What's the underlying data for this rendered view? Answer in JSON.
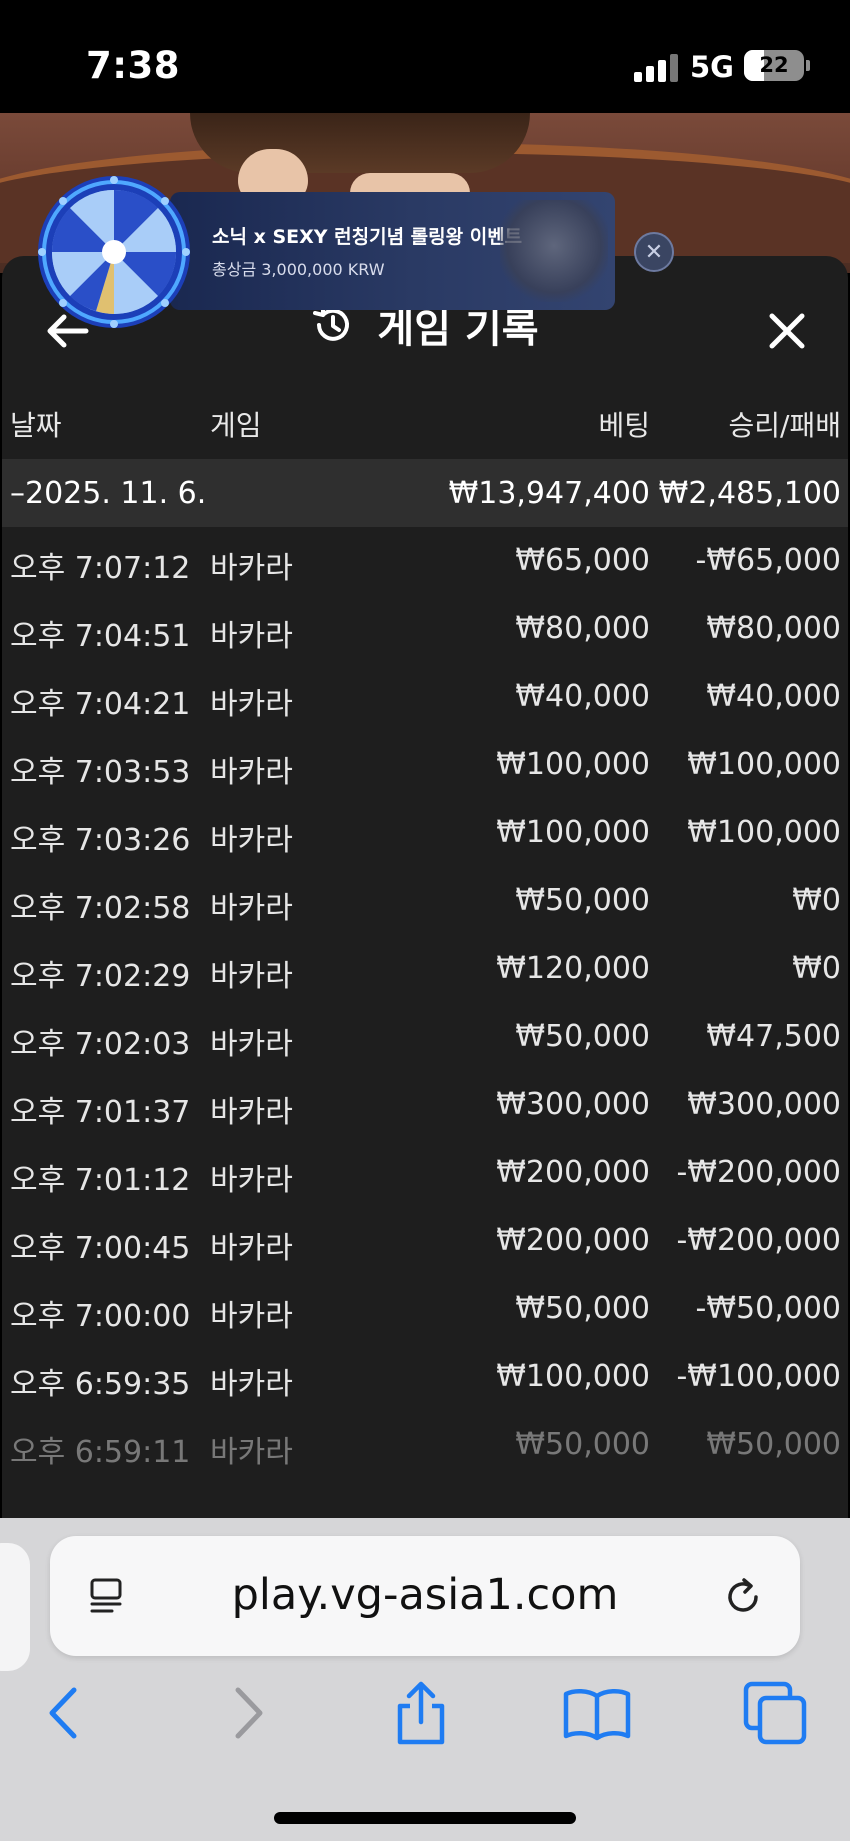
{
  "status_bar": {
    "time": "7:38",
    "network": "5G",
    "battery": "22"
  },
  "ad": {
    "title": "소닉 x SEXY 런칭기념 롤링왕 이벤트",
    "subtitle": "총상금 3,000,000 KRW"
  },
  "modal": {
    "title": "게임 기록",
    "columns": {
      "date": "날짜",
      "game": "게임",
      "bet": "베팅",
      "win_loss": "승리/패배"
    },
    "date_group": {
      "date": "–2025. 11. 6.",
      "bet_total": "₩13,947,400",
      "win_loss_total": "₩2,485,100"
    },
    "rows": [
      {
        "time": "오후 7:07:12",
        "game": "바카라",
        "bet": "₩65,000",
        "win_loss": "-₩65,000"
      },
      {
        "time": "오후 7:04:51",
        "game": "바카라",
        "bet": "₩80,000",
        "win_loss": "₩80,000"
      },
      {
        "time": "오후 7:04:21",
        "game": "바카라",
        "bet": "₩40,000",
        "win_loss": "₩40,000"
      },
      {
        "time": "오후 7:03:53",
        "game": "바카라",
        "bet": "₩100,000",
        "win_loss": "₩100,000"
      },
      {
        "time": "오후 7:03:26",
        "game": "바카라",
        "bet": "₩100,000",
        "win_loss": "₩100,000"
      },
      {
        "time": "오후 7:02:58",
        "game": "바카라",
        "bet": "₩50,000",
        "win_loss": "₩0"
      },
      {
        "time": "오후 7:02:29",
        "game": "바카라",
        "bet": "₩120,000",
        "win_loss": "₩0"
      },
      {
        "time": "오후 7:02:03",
        "game": "바카라",
        "bet": "₩50,000",
        "win_loss": "₩47,500"
      },
      {
        "time": "오후 7:01:37",
        "game": "바카라",
        "bet": "₩300,000",
        "win_loss": "₩300,000"
      },
      {
        "time": "오후 7:01:12",
        "game": "바카라",
        "bet": "₩200,000",
        "win_loss": "-₩200,000"
      },
      {
        "time": "오후 7:00:45",
        "game": "바카라",
        "bet": "₩200,000",
        "win_loss": "-₩200,000"
      },
      {
        "time": "오후 7:00:00",
        "game": "바카라",
        "bet": "₩50,000",
        "win_loss": "-₩50,000"
      },
      {
        "time": "오후 6:59:35",
        "game": "바카라",
        "bet": "₩100,000",
        "win_loss": "-₩100,000"
      },
      {
        "time": "오후 6:59:11",
        "game": "바카라",
        "bet": "₩50,000",
        "win_loss": "₩50,000"
      }
    ]
  },
  "browser": {
    "url": "play.vg-asia1.com"
  },
  "colors": {
    "accent": "#1f7cf2",
    "modal_bg": "#1e1e1e",
    "date_row_bg": "#2f2f2f"
  },
  "icons": [
    "history-icon",
    "back-arrow-icon",
    "close-icon",
    "page-menu-icon",
    "reload-icon",
    "nav-back-icon",
    "nav-forward-icon",
    "share-icon",
    "bookmarks-icon",
    "tabs-icon"
  ]
}
